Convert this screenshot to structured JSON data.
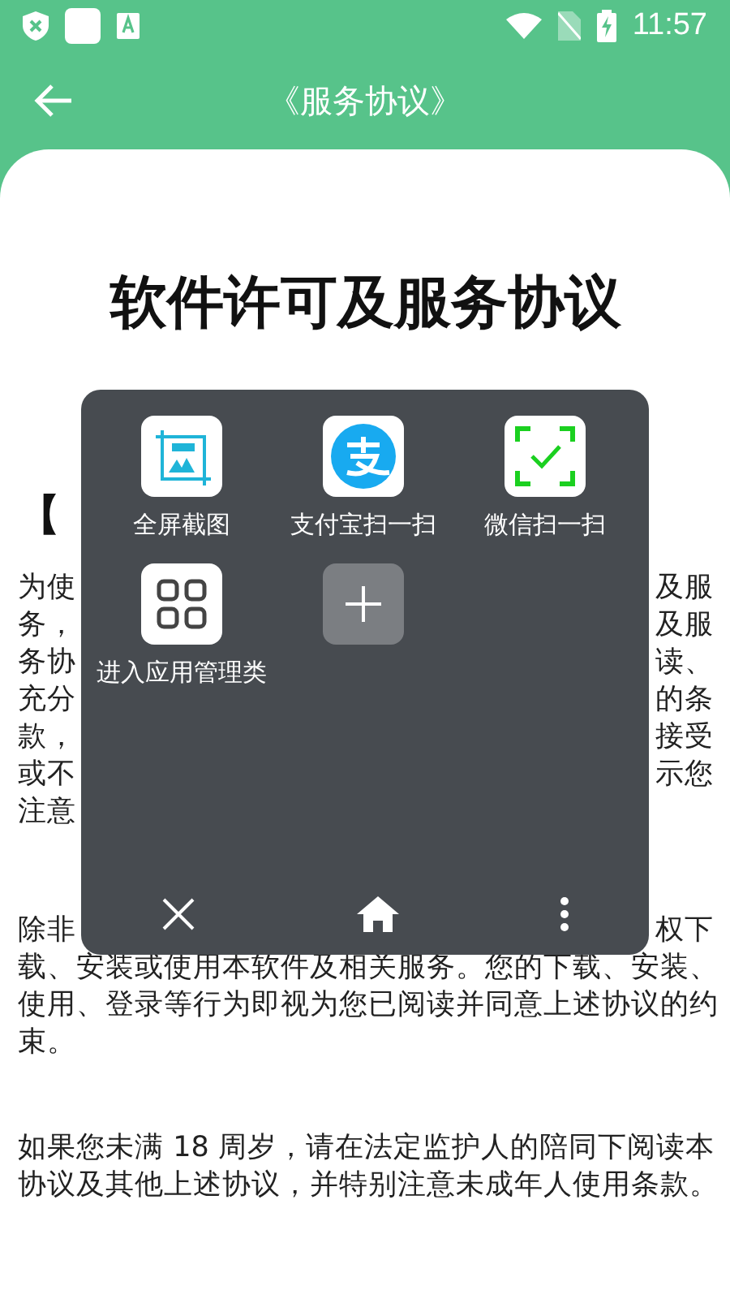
{
  "status_bar": {
    "time": "11:57"
  },
  "app_bar": {
    "title": "《服务协议》"
  },
  "document": {
    "title": "软件许可及服务协议",
    "section_heading": "【",
    "paragraphs": [
      {
        "lines": [
          {
            "left": "为使",
            "right": "及服"
          },
          {
            "left": "务，",
            "right": "及服"
          },
          {
            "left": "务协",
            "right": "读、"
          },
          {
            "left": "充分",
            "right": "的条"
          },
          {
            "left": "款，",
            "right": "接受"
          },
          {
            "left": "或不",
            "right": "示您"
          },
          {
            "left": "注意"
          }
        ]
      },
      {
        "lines": [
          {
            "left": "除非",
            "right": "权下"
          },
          {
            "left": "载、安装或使用本软件及相关服务。您的下载、安装、"
          },
          {
            "left": "使用、登录等行为即视为您已阅读并同意上述协议的约"
          },
          {
            "left": "束。"
          }
        ]
      },
      {
        "lines": [
          {
            "left": "如果您未满 18 周岁，请在法定监护人的陪同下阅读本"
          },
          {
            "left": "协议及其他上述协议，并特别注意未成年人使用条款。"
          }
        ]
      }
    ]
  },
  "quick_panel": {
    "items": [
      {
        "kind": "screenshot",
        "label": "全屏截图"
      },
      {
        "kind": "alipay",
        "label": "支付宝扫一扫"
      },
      {
        "kind": "scan",
        "label": "微信扫一扫"
      },
      {
        "kind": "apps",
        "label": "进入应用管理类"
      },
      {
        "kind": "add"
      }
    ]
  }
}
